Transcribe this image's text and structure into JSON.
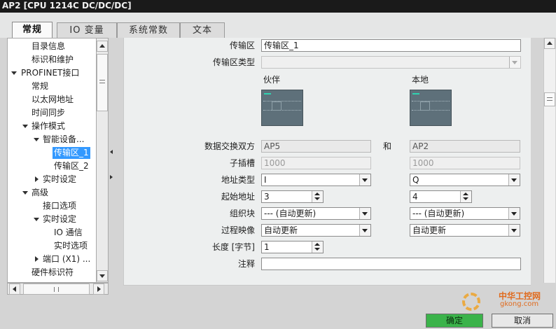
{
  "window": {
    "title": "AP2 [CPU 1214C DC/DC/DC]"
  },
  "tabs": [
    {
      "label": "常规",
      "active": true
    },
    {
      "label": "IO 变量",
      "active": false
    },
    {
      "label": "系统常数",
      "active": false
    },
    {
      "label": "文本",
      "active": false
    }
  ],
  "tree": {
    "items": [
      "目录信息",
      "标识和维护",
      "PROFINET接口",
      "常规",
      "以太网地址",
      "时间同步",
      "操作模式",
      "智能设备...",
      "传输区_1",
      "传输区_2",
      "实时设定",
      "高级",
      "接口选项",
      "实时设定",
      "IO 通信",
      "实时选项",
      "端口 (X1) ...",
      "硬件标识符"
    ],
    "selected": "传输区_1"
  },
  "form": {
    "transfer_area": {
      "label": "传输区",
      "value": "传输区_1"
    },
    "transfer_area_type": {
      "label": "传输区类型",
      "value": ""
    },
    "partner_heading": "伙伴",
    "local_heading": "本地",
    "exchange": {
      "label": "数据交换双方",
      "partner": "AP5",
      "and": "和",
      "local": "AP2"
    },
    "submodule": {
      "label": "子插槽",
      "partner": "1000",
      "local": "1000"
    },
    "address_type": {
      "label": "地址类型",
      "partner": "I",
      "local": "Q"
    },
    "start_address": {
      "label": "起始地址",
      "partner": "3",
      "local": "4"
    },
    "org_block": {
      "label": "组织块",
      "partner": "--- (自动更新)",
      "local": "--- (自动更新)"
    },
    "process_image": {
      "label": "过程映像",
      "partner": "自动更新",
      "local": "自动更新"
    },
    "length": {
      "label": "长度 [字节]",
      "value": "1"
    },
    "comment": {
      "label": "注释",
      "value": ""
    }
  },
  "footer": {
    "ok_label": "确定",
    "cancel_label": "取消"
  },
  "watermark": {
    "text": "中华工控网",
    "url": "gkong.com"
  },
  "colors": {
    "selection": "#3399ff",
    "ok_button": "#3bb34a",
    "title_bar": "#1a1a1a"
  }
}
